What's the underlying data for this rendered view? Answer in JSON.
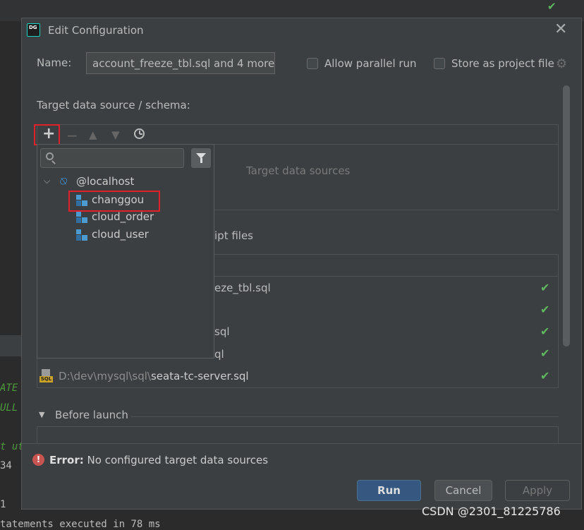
{
  "background": {
    "code_fragments": [
      "ATE",
      "ULL",
      "t ut",
      "34",
      "1"
    ],
    "status_line": "tatements executed in 78 ms"
  },
  "dialog": {
    "title": "Edit Configuration",
    "icon_text": "DG",
    "name_label": "Name:",
    "name_value": "account_freeze_tbl.sql and 4 more",
    "allow_parallel_label": "Allow parallel run",
    "store_project_label": "Store as project file",
    "target_label": "Target data source / schema:",
    "target_placeholder": "Target data sources",
    "scripts_label_fragment": "ipt files",
    "script_fragments": [
      {
        "text": "eze_tbl.sql"
      },
      {
        "text": ""
      },
      {
        "text": "sql"
      },
      {
        "text": "ql"
      }
    ],
    "last_script_path": "D:\\dev\\mysql\\sql\\",
    "last_script_name": "seata-tc-server.sql",
    "before_launch_label": "Before launch",
    "error_bold": "Error:",
    "error_text": "No configured target data sources",
    "buttons": {
      "run": "Run",
      "cancel": "Cancel",
      "apply": "Apply"
    }
  },
  "popup": {
    "search_placeholder": "",
    "host": "@localhost",
    "schemas": [
      "changgou",
      "cloud_order",
      "cloud_user"
    ]
  },
  "watermark": "CSDN @2301_81225786",
  "colors": {
    "accent": "#365880",
    "error": "#c75450",
    "ok": "#5fb85f",
    "highlight": "#e0212c"
  }
}
